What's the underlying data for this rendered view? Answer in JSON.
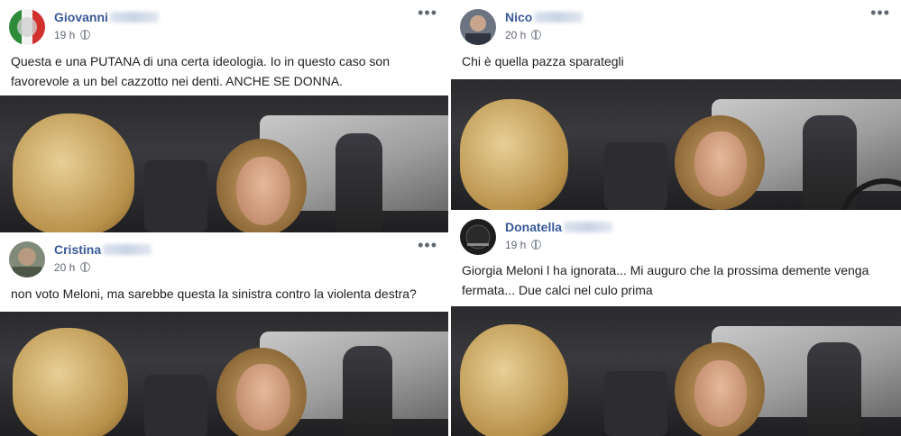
{
  "posts": [
    {
      "author": "Giovanni",
      "time": "19 h",
      "text": "Questa e una PUTANA di una certa ideologia. Io in questo caso son favorevole a un bel cazzotto nei denti. ANCHE SE DONNA.",
      "more": "•••"
    },
    {
      "author": "Nico",
      "time": "20 h",
      "text": "Chi è quella pazza sparategli",
      "more": "•••"
    },
    {
      "author": "Cristina",
      "time": "20 h",
      "text": "non voto Meloni, ma sarebbe questa la sinistra contro la violenta destra?",
      "more": "•••"
    },
    {
      "author": "Donatella",
      "time": "19 h",
      "text": "Giorgia Meloni l ha ignorata... Mi auguro che la prossima demente venga fermata... Due calci nel culo prima",
      "more": "•••"
    }
  ],
  "colors": {
    "name": "#385898",
    "meta": "#616770",
    "text": "#1c1e21"
  }
}
